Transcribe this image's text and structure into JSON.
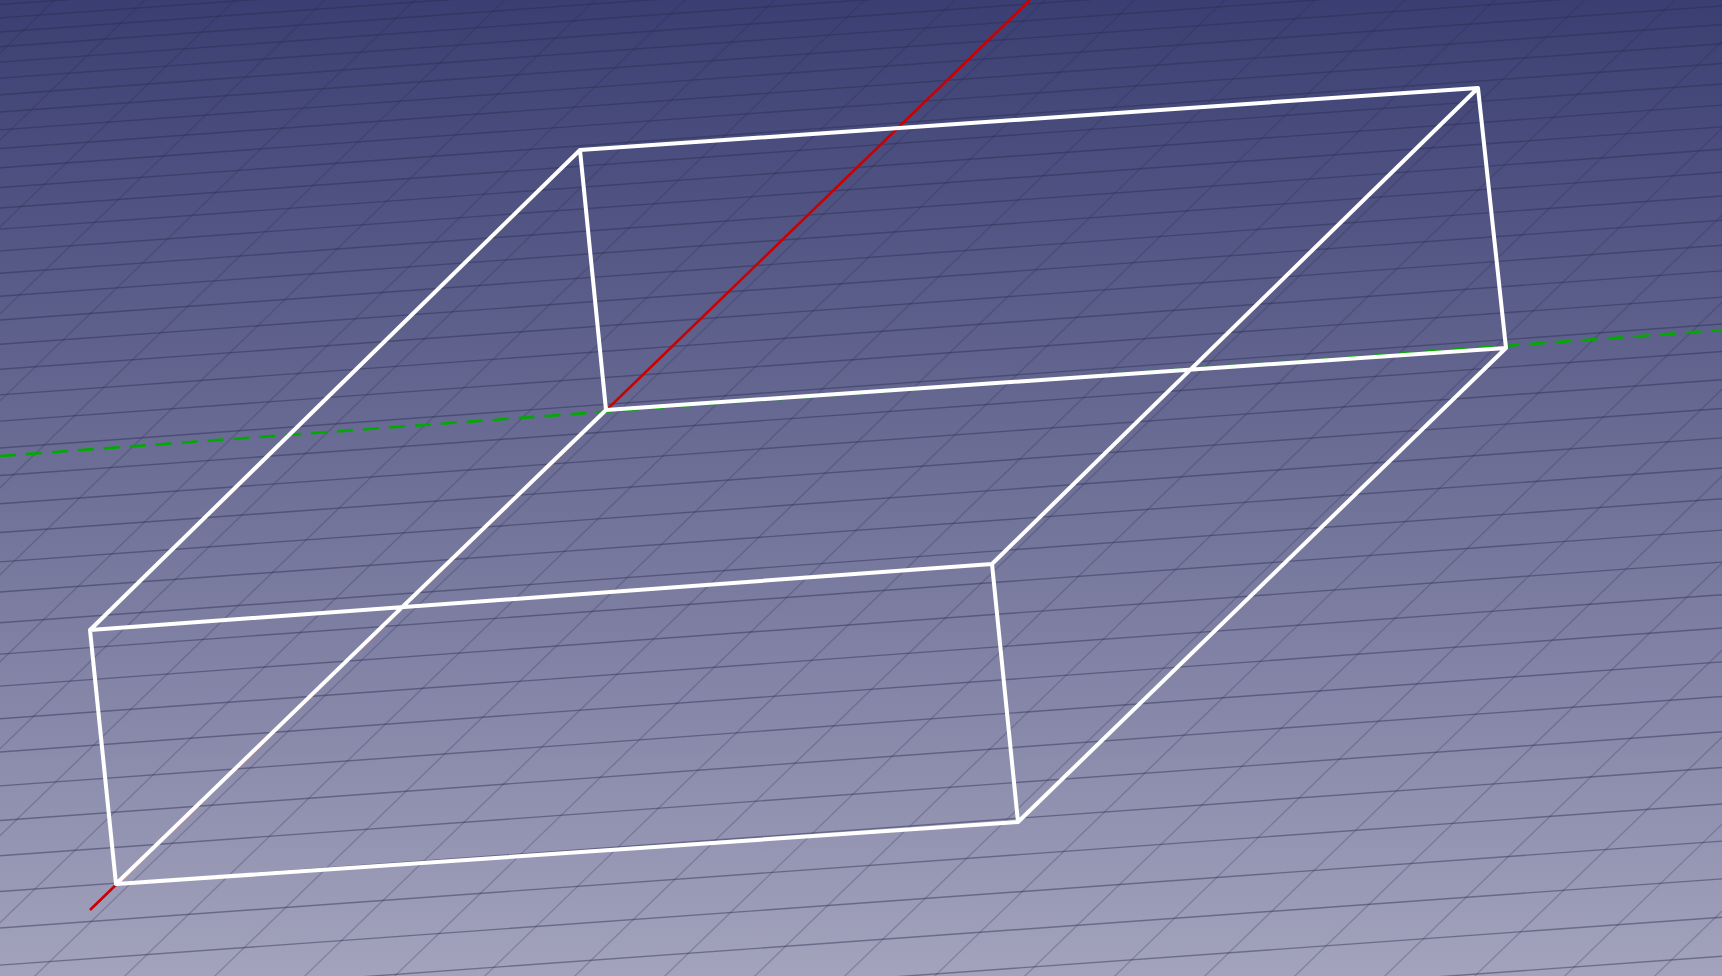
{
  "viewport": {
    "axes": [
      {
        "kind": "x",
        "color": "#cc0000"
      },
      {
        "kind": "y",
        "color": "#00aa00"
      }
    ]
  }
}
